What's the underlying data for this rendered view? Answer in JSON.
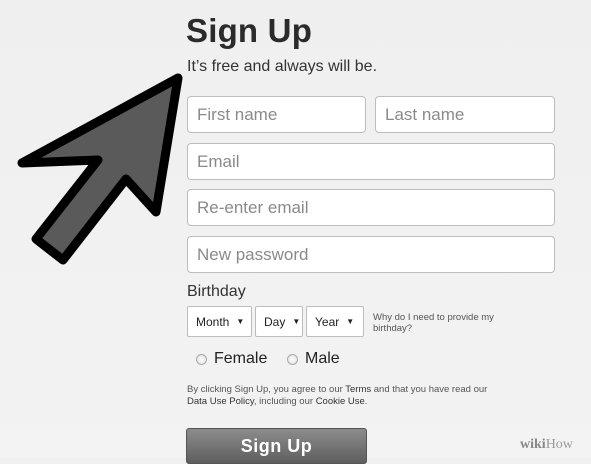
{
  "form": {
    "title": "Sign Up",
    "subtitle": "It’s free and always will be.",
    "first_name_placeholder": "First name",
    "last_name_placeholder": "Last name",
    "email_placeholder": "Email",
    "reenter_email_placeholder": "Re-enter email",
    "password_placeholder": "New password",
    "birthday_label": "Birthday",
    "month_selected": "Month",
    "day_selected": "Day",
    "year_selected": "Year",
    "why_birthday": "Why do I need to provide my birthday?",
    "gender_female": "Female",
    "gender_male": "Male",
    "terms_prefix": "By clicking Sign Up, you agree to our ",
    "terms_link": "Terms",
    "terms_middle": " and that you have read our ",
    "data_use_link": "Data Use Policy",
    "terms_mid2": ", including our ",
    "cookie_link": "Cookie Use",
    "terms_end": ".",
    "signup_button": "Sign Up"
  },
  "watermark": {
    "part1": "wiki",
    "part2": "How"
  },
  "colors": {
    "arrow_fill": "#5a5a5a",
    "arrow_stroke": "#000000",
    "button": "#6e6e6e"
  },
  "icons": {
    "pointer": "arrow-pointer-icon",
    "dropdown": "caret-down-icon"
  }
}
